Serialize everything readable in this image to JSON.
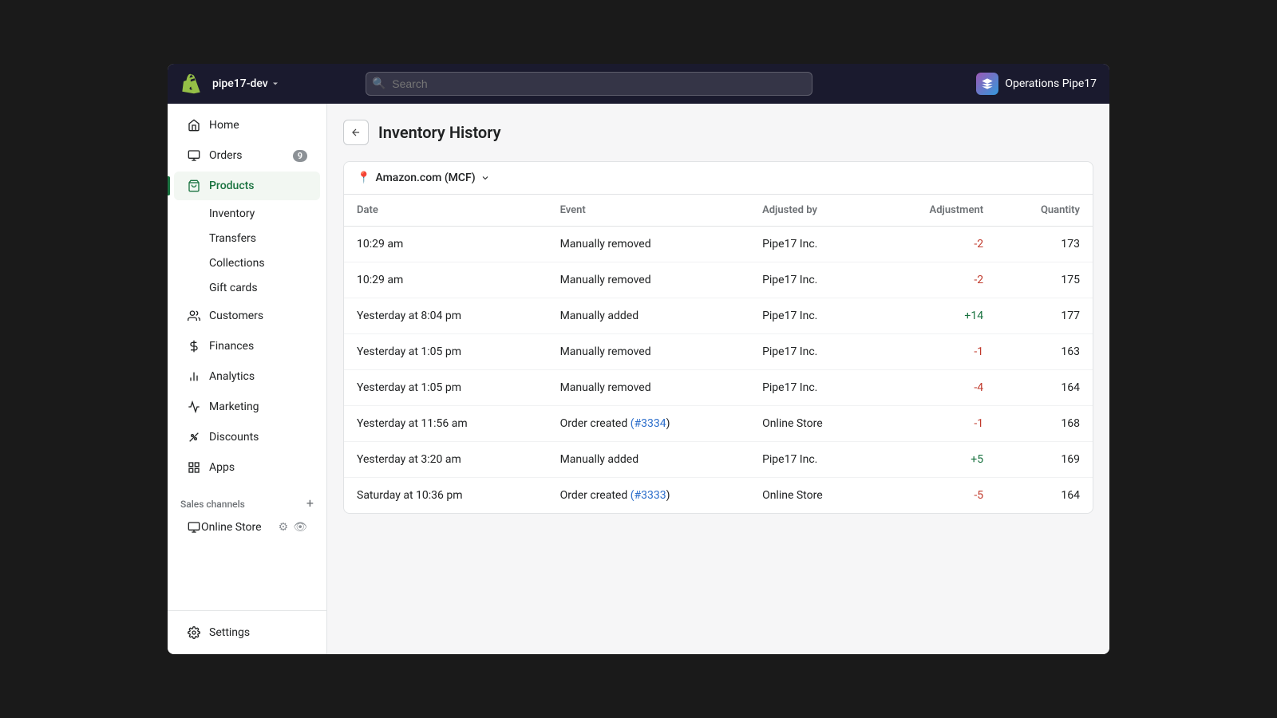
{
  "topbar": {
    "store_name": "pipe17-dev",
    "search_placeholder": "Search",
    "ops_label": "Operations Pipe17"
  },
  "sidebar": {
    "items": [
      {
        "id": "home",
        "label": "Home",
        "icon": "home",
        "badge": null
      },
      {
        "id": "orders",
        "label": "Orders",
        "icon": "orders",
        "badge": "9"
      },
      {
        "id": "products",
        "label": "Products",
        "icon": "products",
        "badge": null,
        "active": true
      }
    ],
    "products_sub": [
      {
        "id": "inventory",
        "label": "Inventory"
      },
      {
        "id": "transfers",
        "label": "Transfers"
      },
      {
        "id": "collections",
        "label": "Collections"
      },
      {
        "id": "gift_cards",
        "label": "Gift cards"
      }
    ],
    "more_items": [
      {
        "id": "customers",
        "label": "Customers",
        "icon": "customers"
      },
      {
        "id": "finances",
        "label": "Finances",
        "icon": "finances"
      },
      {
        "id": "analytics",
        "label": "Analytics",
        "icon": "analytics"
      },
      {
        "id": "marketing",
        "label": "Marketing",
        "icon": "marketing"
      },
      {
        "id": "discounts",
        "label": "Discounts",
        "icon": "discounts"
      },
      {
        "id": "apps",
        "label": "Apps",
        "icon": "apps"
      }
    ],
    "sales_channels_label": "Sales channels",
    "online_store": "Online Store",
    "settings_label": "Settings"
  },
  "page": {
    "title": "Inventory History",
    "location": "Amazon.com (MCF)"
  },
  "table": {
    "headers": [
      "Date",
      "Event",
      "Adjusted by",
      "Adjustment",
      "Quantity"
    ],
    "rows": [
      {
        "date": "10:29 am",
        "event": "Manually removed",
        "event_link": null,
        "adjusted_by": "Pipe17 Inc.",
        "adjustment": "-2",
        "adjustment_type": "negative",
        "quantity": "173"
      },
      {
        "date": "10:29 am",
        "event": "Manually removed",
        "event_link": null,
        "adjusted_by": "Pipe17 Inc.",
        "adjustment": "-2",
        "adjustment_type": "negative",
        "quantity": "175"
      },
      {
        "date": "Yesterday at 8:04 pm",
        "event": "Manually added",
        "event_link": null,
        "adjusted_by": "Pipe17 Inc.",
        "adjustment": "+14",
        "adjustment_type": "positive",
        "quantity": "177"
      },
      {
        "date": "Yesterday at 1:05 pm",
        "event": "Manually removed",
        "event_link": null,
        "adjusted_by": "Pipe17 Inc.",
        "adjustment": "-1",
        "adjustment_type": "negative",
        "quantity": "163"
      },
      {
        "date": "Yesterday at 1:05 pm",
        "event": "Manually removed",
        "event_link": null,
        "adjusted_by": "Pipe17 Inc.",
        "adjustment": "-4",
        "adjustment_type": "negative",
        "quantity": "164"
      },
      {
        "date": "Yesterday at 11:56 am",
        "event": "Order created ",
        "event_link": "#3334",
        "event_suffix": ")",
        "adjusted_by": "Online Store",
        "adjustment": "-1",
        "adjustment_type": "negative",
        "quantity": "168"
      },
      {
        "date": "Yesterday at 3:20 am",
        "event": "Manually added",
        "event_link": null,
        "adjusted_by": "Pipe17 Inc.",
        "adjustment": "+5",
        "adjustment_type": "positive",
        "quantity": "169"
      },
      {
        "date": "Saturday at 10:36 pm",
        "event": "Order created ",
        "event_link": "#3333",
        "event_suffix": ")",
        "adjusted_by": "Online Store",
        "adjustment": "-5",
        "adjustment_type": "negative",
        "quantity": "164"
      }
    ]
  }
}
